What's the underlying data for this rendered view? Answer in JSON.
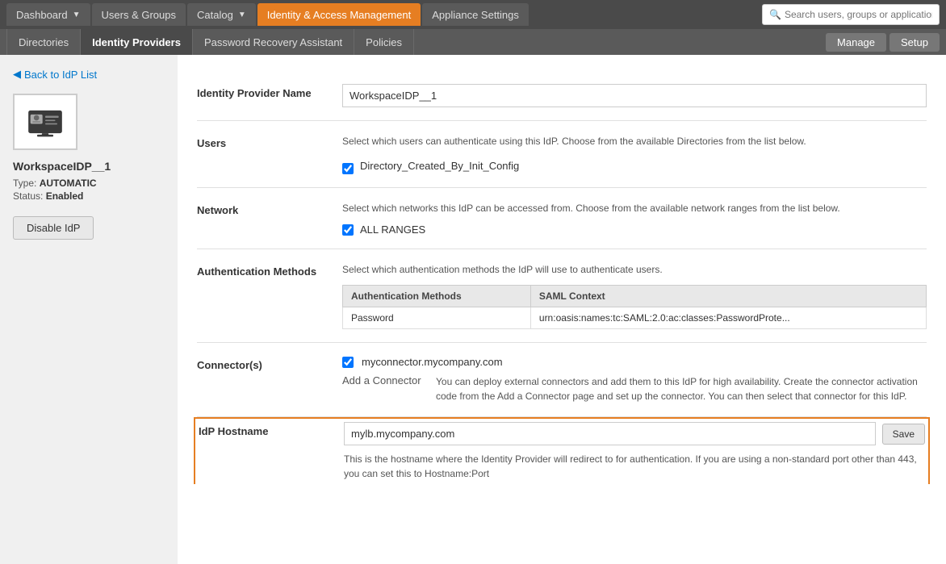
{
  "topNav": {
    "buttons": [
      {
        "label": "Dashboard",
        "hasDropdown": true,
        "active": false
      },
      {
        "label": "Users & Groups",
        "hasDropdown": false,
        "active": false
      },
      {
        "label": "Catalog",
        "hasDropdown": true,
        "active": false
      },
      {
        "label": "Identity & Access Management",
        "hasDropdown": false,
        "active": true
      },
      {
        "label": "Appliance Settings",
        "hasDropdown": false,
        "active": false
      }
    ],
    "search": {
      "placeholder": "Search users, groups or applications"
    }
  },
  "subNav": {
    "items": [
      {
        "label": "Directories",
        "active": false
      },
      {
        "label": "Identity Providers",
        "active": true
      },
      {
        "label": "Password Recovery Assistant",
        "active": false
      },
      {
        "label": "Policies",
        "active": false
      }
    ],
    "rightButtons": [
      {
        "label": "Manage"
      },
      {
        "label": "Setup"
      }
    ]
  },
  "backLink": "Back to IdP List",
  "idp": {
    "name": "WorkspaceIDP__1",
    "type": "AUTOMATIC",
    "status": "Enabled",
    "disableButton": "Disable IdP"
  },
  "form": {
    "idpNameLabel": "Identity Provider Name",
    "idpNameValue": "WorkspaceIDP__1",
    "usersLabel": "Users",
    "usersDesc": "Select which users can authenticate using this IdP. Choose from the available Directories from the list below.",
    "usersCheckbox": {
      "checked": true,
      "label": "Directory_Created_By_Init_Config"
    },
    "networkLabel": "Network",
    "networkDesc": "Select which networks this IdP can be accessed from. Choose from the available network ranges from the list below.",
    "networkCheckbox": {
      "checked": true,
      "label": "ALL RANGES"
    },
    "authMethodsLabel": "Authentication Methods",
    "authMethodsDesc": "Select which authentication methods the IdP will use to authenticate users.",
    "authTable": {
      "columns": [
        "Authentication Methods",
        "SAML Context"
      ],
      "rows": [
        {
          "method": "Password",
          "saml": "urn:oasis:names:tc:SAML:2.0:ac:classes:PasswordProte..."
        }
      ]
    },
    "connectorsLabel": "Connector(s)",
    "connector": {
      "checked": true,
      "name": "myconnector.mycompany.com"
    },
    "addConnectorLabel": "Add a Connector",
    "addConnectorDesc": "You can deploy external connectors and add them to this IdP for high availability. Create the connector activation code from the Add a Connector page and set up the connector. You can then select that connector for this IdP.",
    "idpHostnameLabel": "IdP Hostname",
    "idpHostnameValue": "mylb.mycompany.com",
    "idpHostnameEditBtn": "Save",
    "idpHostnameDesc": "This is the hostname where the Identity Provider will redirect to for authentication. If you are using a non-standard port other than 443, you can set this to Hostname:Port"
  }
}
